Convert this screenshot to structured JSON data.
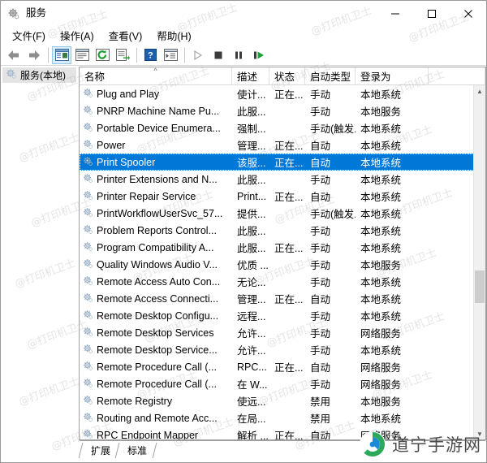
{
  "window": {
    "title": "服务",
    "icon": "services-gear-icon",
    "minimize_label": "—",
    "maximize_label": "□",
    "close_label": "✕"
  },
  "menu": {
    "items": [
      {
        "label": "文件(F)",
        "name": "menu-file"
      },
      {
        "label": "操作(A)",
        "name": "menu-action"
      },
      {
        "label": "查看(V)",
        "name": "menu-view"
      },
      {
        "label": "帮助(H)",
        "name": "menu-help"
      }
    ]
  },
  "toolbar": {
    "buttons": [
      {
        "name": "back-arrow-icon",
        "label": "后退"
      },
      {
        "name": "forward-arrow-icon",
        "label": "前进"
      },
      {
        "name": "show-hide-tree-icon",
        "label": "显示/隐藏控制台树"
      },
      {
        "name": "properties-window-icon",
        "label": "属性"
      },
      {
        "name": "refresh-icon",
        "label": "刷新"
      },
      {
        "name": "export-list-icon",
        "label": "导出列表"
      },
      {
        "name": "help-icon",
        "label": "帮助"
      },
      {
        "name": "detail-view-icon",
        "label": "详细信息"
      },
      {
        "name": "start-service-icon",
        "label": "启动服务"
      },
      {
        "name": "stop-service-icon",
        "label": "停止服务"
      },
      {
        "name": "pause-service-icon",
        "label": "暂停服务"
      },
      {
        "name": "restart-service-icon",
        "label": "重启服务"
      }
    ]
  },
  "tree": {
    "root_label": "服务(本地)"
  },
  "list": {
    "columns": [
      {
        "label": "名称",
        "name": "column-name",
        "width": 188,
        "sorted": true
      },
      {
        "label": "描述",
        "name": "column-description",
        "width": 46
      },
      {
        "label": "状态",
        "name": "column-status",
        "width": 44
      },
      {
        "label": "启动类型",
        "name": "column-startup-type",
        "width": 62
      },
      {
        "label": "登录为",
        "name": "column-logon-as",
        "width": 90
      },
      {
        "label": "",
        "name": "column-filler",
        "width": 50
      }
    ],
    "sort_indicator": "^",
    "rows": [
      {
        "name": "Plug and Play",
        "description": "使计...",
        "status": "正在...",
        "startup": "手动",
        "logon": "本地系统",
        "selected": false
      },
      {
        "name": "PNRP Machine Name Pu...",
        "description": "此服...",
        "status": "",
        "startup": "手动",
        "logon": "本地服务",
        "selected": false
      },
      {
        "name": "Portable Device Enumera...",
        "description": "强制...",
        "status": "",
        "startup": "手动(触发...",
        "logon": "本地系统",
        "selected": false
      },
      {
        "name": "Power",
        "description": "管理...",
        "status": "正在...",
        "startup": "自动",
        "logon": "本地系统",
        "selected": false
      },
      {
        "name": "Print Spooler",
        "description": "该服...",
        "status": "正在...",
        "startup": "自动",
        "logon": "本地系统",
        "selected": true
      },
      {
        "name": "Printer Extensions and N...",
        "description": "此服...",
        "status": "",
        "startup": "手动",
        "logon": "本地系统",
        "selected": false
      },
      {
        "name": "Printer Repair Service",
        "description": "Print...",
        "status": "正在...",
        "startup": "自动",
        "logon": "本地系统",
        "selected": false
      },
      {
        "name": "PrintWorkflowUserSvc_57...",
        "description": "提供...",
        "status": "",
        "startup": "手动(触发...",
        "logon": "本地系统",
        "selected": false
      },
      {
        "name": "Problem Reports Control...",
        "description": "此服...",
        "status": "",
        "startup": "手动",
        "logon": "本地系统",
        "selected": false
      },
      {
        "name": "Program Compatibility A...",
        "description": "此服...",
        "status": "正在...",
        "startup": "手动",
        "logon": "本地系统",
        "selected": false
      },
      {
        "name": "Quality Windows Audio V...",
        "description": "优质 ...",
        "status": "",
        "startup": "手动",
        "logon": "本地服务",
        "selected": false
      },
      {
        "name": "Remote Access Auto Con...",
        "description": "无论...",
        "status": "",
        "startup": "手动",
        "logon": "本地系统",
        "selected": false
      },
      {
        "name": "Remote Access Connecti...",
        "description": "管理...",
        "status": "正在...",
        "startup": "自动",
        "logon": "本地系统",
        "selected": false
      },
      {
        "name": "Remote Desktop Configu...",
        "description": "远程...",
        "status": "",
        "startup": "手动",
        "logon": "本地系统",
        "selected": false
      },
      {
        "name": "Remote Desktop Services",
        "description": "允许...",
        "status": "",
        "startup": "手动",
        "logon": "网络服务",
        "selected": false
      },
      {
        "name": "Remote Desktop Service...",
        "description": "允许...",
        "status": "",
        "startup": "手动",
        "logon": "本地系统",
        "selected": false
      },
      {
        "name": "Remote Procedure Call (...",
        "description": "RPC...",
        "status": "正在...",
        "startup": "自动",
        "logon": "网络服务",
        "selected": false
      },
      {
        "name": "Remote Procedure Call (...",
        "description": "在 W...",
        "status": "",
        "startup": "手动",
        "logon": "网络服务",
        "selected": false
      },
      {
        "name": "Remote Registry",
        "description": "使远...",
        "status": "",
        "startup": "禁用",
        "logon": "本地服务",
        "selected": false
      },
      {
        "name": "Routing and Remote Acc...",
        "description": "在局...",
        "status": "",
        "startup": "禁用",
        "logon": "本地系统",
        "selected": false
      },
      {
        "name": "RPC Endpoint Mapper",
        "description": "解析 ...",
        "status": "正在...",
        "startup": "自动",
        "logon": "网络服务",
        "selected": false
      }
    ]
  },
  "tabs": [
    {
      "label": "扩展",
      "name": "tab-extended",
      "selected": false
    },
    {
      "label": "标准",
      "name": "tab-standard",
      "selected": true
    }
  ],
  "watermarks": {
    "text": "@打印机卫士",
    "brand_text": "道宁手游网"
  },
  "colors": {
    "selection": "#0078d7",
    "tree_selection": "#e4e4e4",
    "brand_green": "#2aa95a",
    "brand_blue": "#1c8ad6"
  }
}
